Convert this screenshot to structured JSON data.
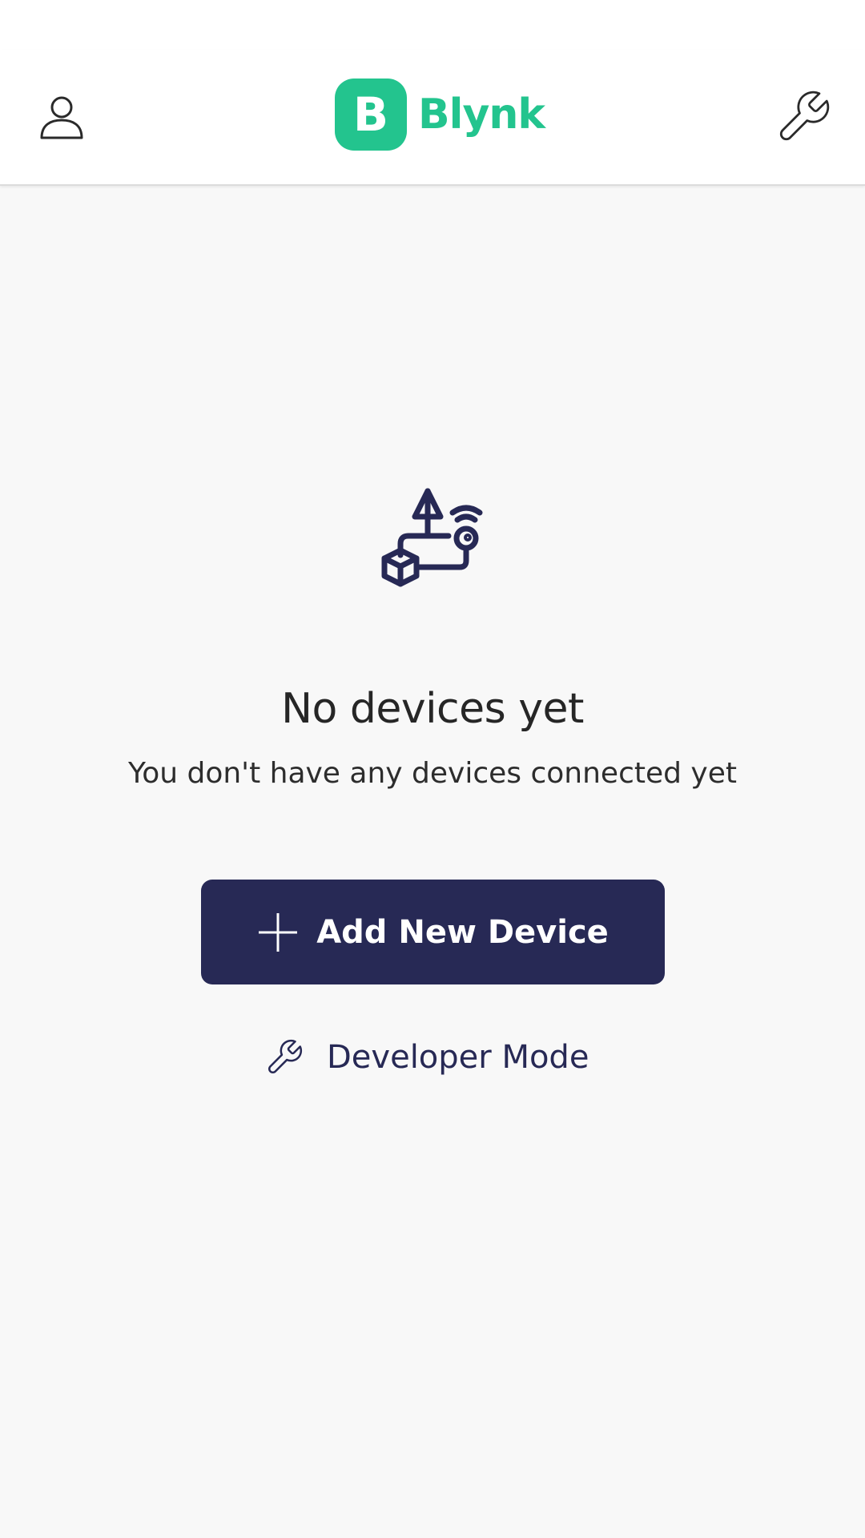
{
  "header": {
    "logo_letter": "B",
    "logo_text": "Blynk",
    "profile_icon": "user-icon",
    "settings_icon": "wrench-icon"
  },
  "empty_state": {
    "illustration_icon": "devices-network-icon",
    "title": "No devices yet",
    "subtitle": "You don't have any devices connected yet"
  },
  "actions": {
    "add_device_label": "Add New Device",
    "add_device_icon": "plus-icon",
    "developer_mode_label": "Developer Mode",
    "developer_mode_icon": "wrench-icon"
  },
  "colors": {
    "brand_green": "#23c48e",
    "primary_navy": "#272955",
    "header_icon": "#2a2a2a",
    "background": "#f8f8f8"
  }
}
